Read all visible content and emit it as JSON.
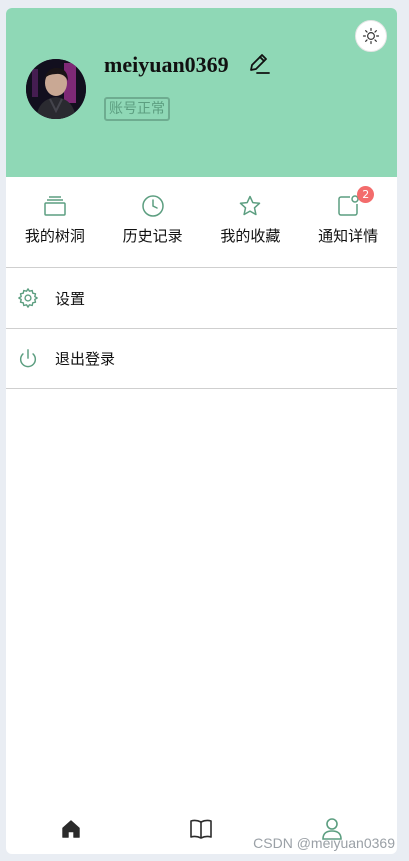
{
  "profile": {
    "username": "meiyuan0369",
    "status": "账号正常"
  },
  "quick_links": [
    {
      "label": "我的树洞",
      "icon": "tree-hole-icon"
    },
    {
      "label": "历史记录",
      "icon": "clock-icon"
    },
    {
      "label": "我的收藏",
      "icon": "star-icon"
    },
    {
      "label": "通知详情",
      "icon": "notification-icon",
      "badge": "2"
    }
  ],
  "menu": [
    {
      "label": "设置",
      "icon": "gear-icon"
    },
    {
      "label": "退出登录",
      "icon": "power-icon"
    }
  ],
  "tabbar": [
    {
      "name": "home",
      "icon": "home-icon"
    },
    {
      "name": "book",
      "icon": "book-icon"
    },
    {
      "name": "profile",
      "icon": "user-icon"
    }
  ],
  "watermark": "CSDN @meiyuan0369",
  "colors": {
    "header_bg": "#8fd8b6",
    "accent": "#6eac90",
    "badge": "#f36c6c"
  }
}
